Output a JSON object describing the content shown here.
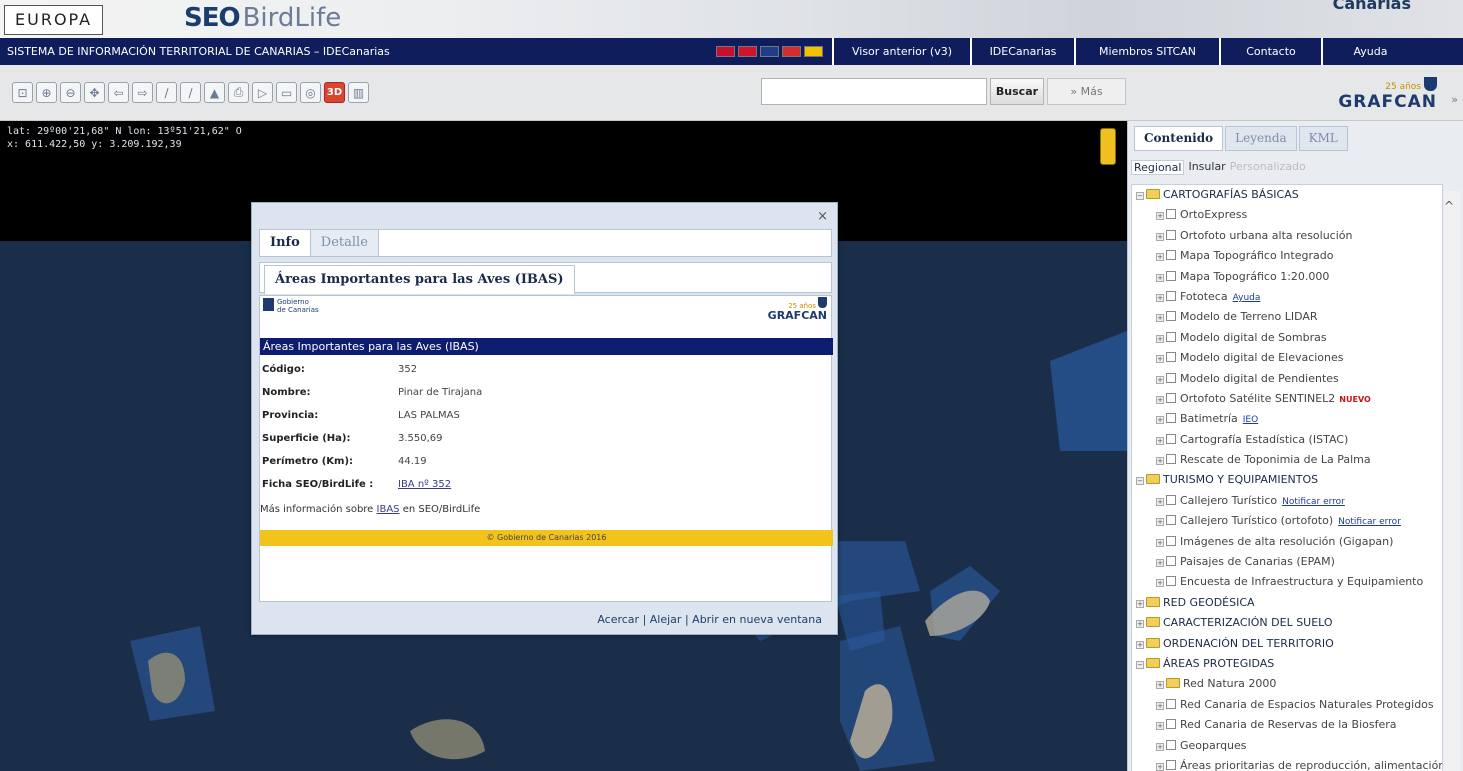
{
  "banner": {
    "badge": "EUROPA",
    "seo_bold": "SEO",
    "seo_light": "BirdLife",
    "canarias": "Canarias"
  },
  "navbar": {
    "title": "SISTEMA DE INFORMACIÓN TERRITORIAL DE CANARIAS – IDECanarias",
    "flag_colors": [
      "#c8102e",
      "#cf142b",
      "#1f3d8a",
      "#d22e2e",
      "#f2c100"
    ],
    "links": [
      {
        "label": "Visor anterior (v3)"
      },
      {
        "label": "IDECanarias"
      },
      {
        "label": "Miembros SITCAN"
      },
      {
        "label": "Contacto"
      },
      {
        "label": "Ayuda"
      }
    ]
  },
  "toolbar": {
    "tools": [
      "zoom-extent-icon",
      "zoom-in-icon",
      "zoom-out-icon",
      "pan-icon",
      "previous-view-icon",
      "next-view-icon",
      "measure-distance-icon",
      "measure-area-icon",
      "profile-icon",
      "print-icon",
      "select-icon",
      "legend-icon",
      "layers-icon",
      "3d-icon",
      "compare-icon"
    ],
    "tool_glyphs": [
      "⊡",
      "⊕",
      "⊖",
      "✥",
      "⇦",
      "⇨",
      "∕",
      "∕",
      "▲",
      "⎙",
      "▷",
      "▭",
      "◎",
      "3D",
      "▥"
    ],
    "search_placeholder": "",
    "search_label": "Buscar",
    "more_label": "» Más",
    "grafcan_years": "25 años",
    "grafcan_name": "GRAFCAN",
    "expand_glyph": "»"
  },
  "map": {
    "coord_line1": "lat: 29º00'21,68\" N  lon: 13º51'21,62\" O",
    "coord_line2": "x: 611.422,50  y: 3.209.192,39"
  },
  "popup": {
    "close_glyph": "×",
    "tab_info": "Info",
    "tab_detalle": "Detalle",
    "layer_tab": "Áreas Importantes para las Aves (IBAS)",
    "gobierno_line1": "Gobierno",
    "gobierno_line2": "de Canarias",
    "grafcan_years": "25 años",
    "grafcan_name": "GRAFCAN",
    "section_title": "Áreas Importantes para las Aves (IBAS)",
    "attributes": [
      {
        "key": "Código:",
        "value": "352"
      },
      {
        "key": "Nombre:",
        "value": "Pinar de Tirajana"
      },
      {
        "key": "Provincia:",
        "value": "LAS PALMAS"
      },
      {
        "key": "Superficie (Ha):",
        "value": "3.550,69"
      },
      {
        "key": "Perímetro (Km):",
        "value": "44.19"
      },
      {
        "key": "Ficha SEO/BirdLife :",
        "value": "IBA nº 352"
      }
    ],
    "more_info_prefix": "Más información sobre",
    "more_info_link": "IBAS",
    "more_info_suffix": "en SEO/BirdLife",
    "copyright": "© Gobierno de Canarias 2016",
    "footer_acercar": "Acercar",
    "footer_sep": "|",
    "footer_alejar": "Alejar",
    "footer_abrir": "Abrir en nueva ventana"
  },
  "panel": {
    "tabs": [
      "Contenido",
      "Leyenda",
      "KML"
    ],
    "subtabs": [
      "Regional",
      "Insular",
      "Personalizado"
    ],
    "tree": [
      {
        "level": 0,
        "label": "CARTOGRAFÍAS BÁSICAS",
        "open": true
      },
      {
        "level": 1,
        "label": "OrtoExpress"
      },
      {
        "level": 1,
        "label": "Ortofoto urbana alta resolución"
      },
      {
        "level": 1,
        "label": "Mapa Topográfico Integrado"
      },
      {
        "level": 1,
        "label": "Mapa Topográfico 1:20.000"
      },
      {
        "level": 1,
        "label": "Fototeca",
        "link": "Ayuda"
      },
      {
        "level": 1,
        "label": "Modelo de Terreno LIDAR"
      },
      {
        "level": 1,
        "label": "Modelo digital de Sombras"
      },
      {
        "level": 1,
        "label": "Modelo digital de Elevaciones"
      },
      {
        "level": 1,
        "label": "Modelo digital de Pendientes"
      },
      {
        "level": 1,
        "label": "Ortofoto Satélite SENTINEL2",
        "badge": "NUEVO"
      },
      {
        "level": 1,
        "label": "Batimetría",
        "link": "IEO"
      },
      {
        "level": 1,
        "label": "Cartografía Estadística (ISTAC)"
      },
      {
        "level": 1,
        "label": "Rescate de Toponimia de La Palma"
      },
      {
        "level": 0,
        "label": "TURISMO Y EQUIPAMIENTOS",
        "open": true
      },
      {
        "level": 1,
        "label": "Callejero Turístico",
        "link": "Notificar error"
      },
      {
        "level": 1,
        "label": "Callejero Turístico (ortofoto)",
        "link": "Notificar error"
      },
      {
        "level": 1,
        "label": "Imágenes de alta resolución (Gigapan)"
      },
      {
        "level": 1,
        "label": "Paisajes de Canarias (EPAM)"
      },
      {
        "level": 1,
        "label": "Encuesta de Infraestructura y Equipamiento"
      },
      {
        "level": 0,
        "label": "RED GEODÉSICA",
        "open": false
      },
      {
        "level": 0,
        "label": "CARACTERIZACIÓN DEL SUELO",
        "open": false
      },
      {
        "level": 0,
        "label": "ORDENACIÓN DEL TERRITORIO",
        "open": false
      },
      {
        "level": 0,
        "label": "ÁREAS PROTEGIDAS",
        "open": true
      },
      {
        "level": 1,
        "label": "Red Natura 2000",
        "folder": true
      },
      {
        "level": 1,
        "label": "Red Canaria de Espacios Naturales Protegidos"
      },
      {
        "level": 1,
        "label": "Red Canaria de Reservas de la Biosfera"
      },
      {
        "level": 1,
        "label": "Geoparques"
      },
      {
        "level": 1,
        "label": "Áreas prioritarias de reproducción, alimentación"
      }
    ],
    "scroll_up_glyph": "^"
  }
}
